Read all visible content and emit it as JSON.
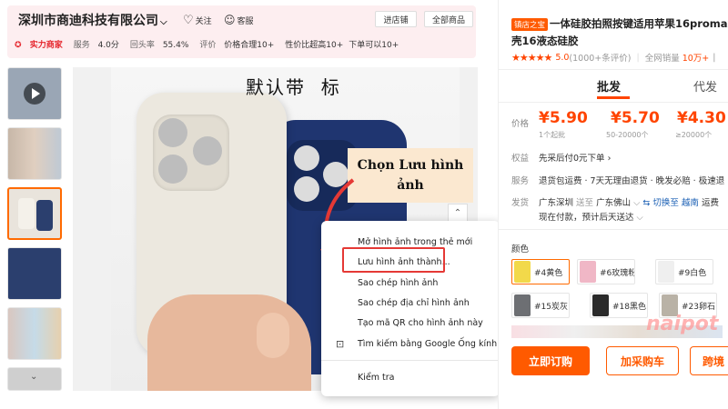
{
  "shop": {
    "name": "深圳市商迪科技有限公司",
    "follow_label": "关注",
    "service_label": "客服",
    "enter_shop_label": "进店铺",
    "all_products_label": "全部商品",
    "strong_merchant_label": "实力商家",
    "metrics": [
      {
        "label": "服务",
        "value": "4.0分"
      },
      {
        "label": "回头率",
        "value": "55.4%"
      },
      {
        "label": "评价",
        "value": "价格合理10+"
      },
      {
        "label": "",
        "value": "性价比超高10+"
      },
      {
        "label": "",
        "value": "下单可以10+"
      }
    ]
  },
  "gallery": {
    "photo_title": "默认带  标",
    "thumb_colors": [
      "#9aa6b5",
      "#c7b7a8",
      "#e9e4dc",
      "#2b3f6e",
      "#d9c7c0",
      "#cfcfcf"
    ]
  },
  "context_menu": {
    "items": [
      "Mở hình ảnh trong thẻ mới",
      "Lưu hình ảnh thành...",
      "Sao chép hình ảnh",
      "Sao chép địa chỉ hình ảnh",
      "Tạo mã QR cho hình ảnh này",
      "Tìm kiếm bằng Google Ống kính",
      "Kiểm tra"
    ]
  },
  "callout": {
    "line1": "Chọn Lưu hình",
    "line2": "ảnh"
  },
  "product": {
    "store_tag": "镇店之宝",
    "title_line1": "一体硅胶拍照按键适用苹果16promax摄",
    "title_line2": "壳16液态硅胶",
    "rating": "5.0",
    "reviews": "(1000+条评价)",
    "sales_label": "全网销量",
    "sales_value": "10万+",
    "tab_wholesale": "批发",
    "tab_dropship": "代发",
    "price_label": "价格",
    "prices": [
      {
        "value": "¥5.90",
        "note": "1个起批"
      },
      {
        "value": "¥5.70",
        "note": "50-20000个"
      },
      {
        "value": "¥4.30",
        "note": "≥20000个"
      }
    ],
    "benefit_label": "权益",
    "benefit_text": "先采后付0元下单",
    "service_label": "服务",
    "service_text": "退货包运费 · 7天无理由退货 · 晚发必赔 · 极速退",
    "ship_label": "发货",
    "ship_from": "广东深圳",
    "ship_to_word": "送至",
    "ship_to": "广东佛山",
    "ship_switch": "切换至",
    "ship_region": "越南",
    "ship_fee": "运费",
    "ship_line2": "现在付款，预计后天送达",
    "color_label": "颜色",
    "colors": [
      {
        "name": "#4黄色",
        "hex": "#f2d94a"
      },
      {
        "name": "#6玫瑰粉",
        "hex": "#f0b7c6"
      },
      {
        "name": "#9白色",
        "hex": "#efefef"
      },
      {
        "name": "#15炭灰",
        "hex": "#6d6f73"
      },
      {
        "name": "#18黑色",
        "hex": "#2a2a2a"
      },
      {
        "name": "#23卵石",
        "hex": "#b9b2a6"
      }
    ],
    "buy_now": "立即订购",
    "add_cart": "加采购车",
    "dropship": "跨境"
  },
  "watermark": "naipot",
  "colors": {
    "accent": "#ff4400",
    "brand_orange": "#ff6a00",
    "highlight_red": "#e53935"
  }
}
